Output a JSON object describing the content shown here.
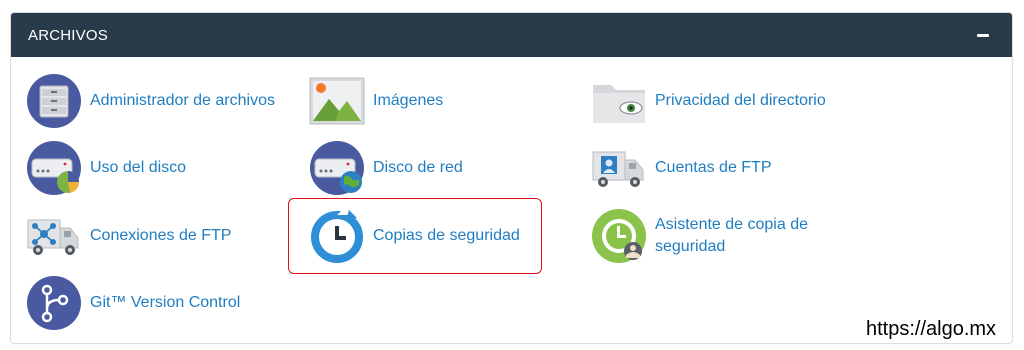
{
  "section": {
    "title": "ARCHIVOS",
    "collapse_icon": "minus-icon"
  },
  "items": [
    {
      "label": "Administrador de archivos",
      "icon": "file-cabinet-icon"
    },
    {
      "label": "Imágenes",
      "icon": "image-icon"
    },
    {
      "label": "Privacidad del directorio",
      "icon": "folder-eye-icon"
    },
    {
      "label": "Uso del disco",
      "icon": "disk-usage-icon"
    },
    {
      "label": "Disco de red",
      "icon": "network-disk-icon"
    },
    {
      "label": "Cuentas de FTP",
      "icon": "ftp-truck-user-icon"
    },
    {
      "label": "Conexiones de FTP",
      "icon": "ftp-truck-network-icon"
    },
    {
      "label": "Copias de seguridad",
      "icon": "backup-clock-icon"
    },
    {
      "label": "Asistente de copia de seguridad",
      "icon": "backup-wizard-icon"
    },
    {
      "label": "Git™ Version Control",
      "icon": "git-branch-icon"
    }
  ],
  "colors": {
    "header_bg": "#293a4a",
    "link": "#1f7ec1",
    "highlight": "#e0121c"
  },
  "watermark": "https://algo.mx"
}
